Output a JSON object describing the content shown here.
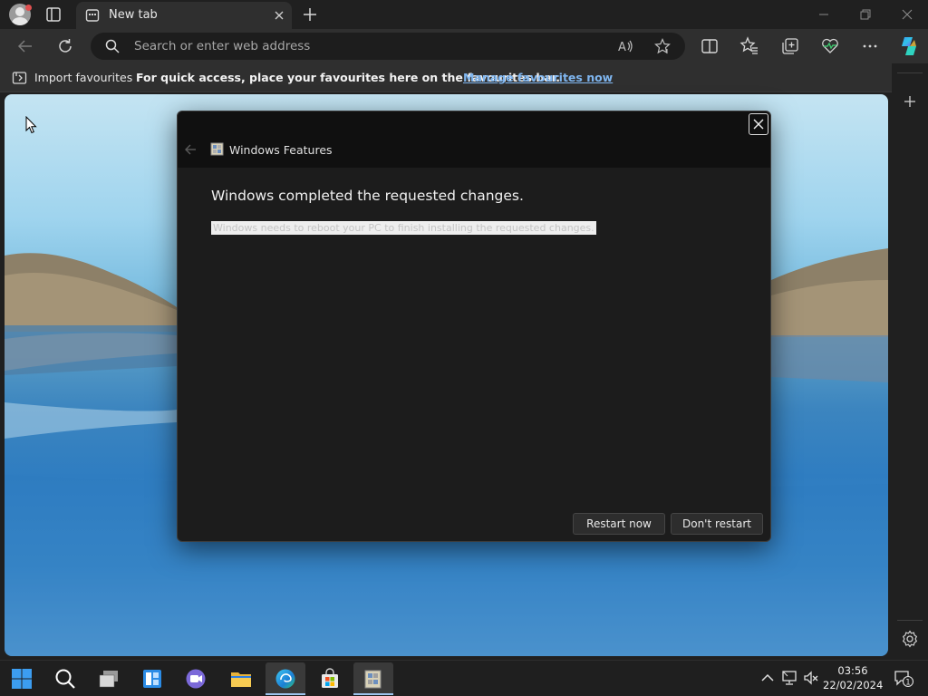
{
  "browser": {
    "tab_title": "New tab",
    "address_placeholder": "Search or enter web address"
  },
  "favourites_bar": {
    "import_label": "Import favourites",
    "hint": "For quick access, place your favourites here on the favourites bar.",
    "manage_link": "Manage favourites now"
  },
  "dialog": {
    "title": "Windows Features",
    "heading": "Windows completed the requested changes.",
    "message": "Windows needs to reboot your PC to finish installing the requested changes.",
    "restart_label": "Restart now",
    "dont_restart_label": "Don't restart"
  },
  "taskbar": {
    "time": "03:56",
    "date": "22/02/2024",
    "notification_count": "1"
  },
  "colors": {
    "accent_link": "#7fb6f0",
    "dialog_bg": "#1c1c1c",
    "taskbar_bg": "#1f1f1f"
  }
}
